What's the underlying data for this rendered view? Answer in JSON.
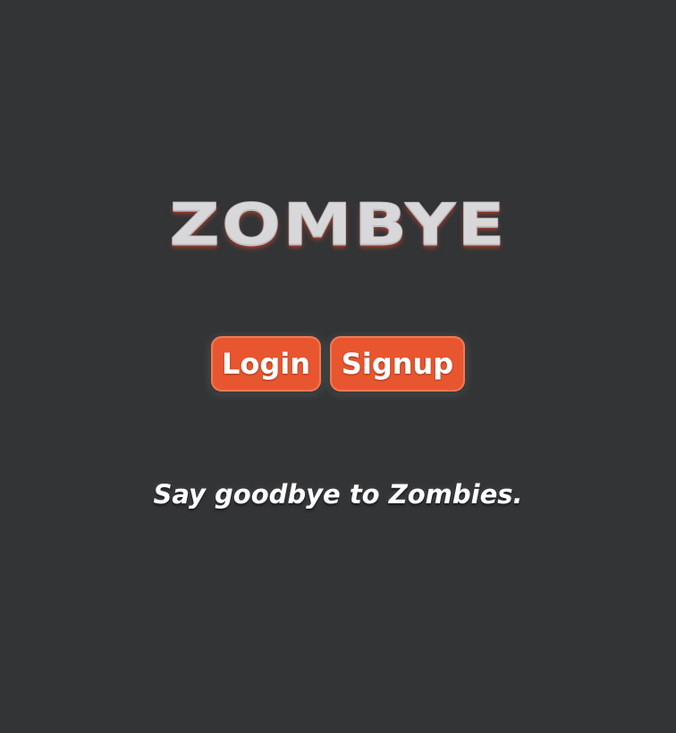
{
  "brand": {
    "logo_text": "ZOMBYE"
  },
  "actions": {
    "login_label": "Login",
    "signup_label": "Signup"
  },
  "tagline": "Say goodbye to Zombies.",
  "colors": {
    "background": "#333436",
    "accent": "#e8562f",
    "logo": "#d8d8da",
    "text": "#ffffff"
  }
}
